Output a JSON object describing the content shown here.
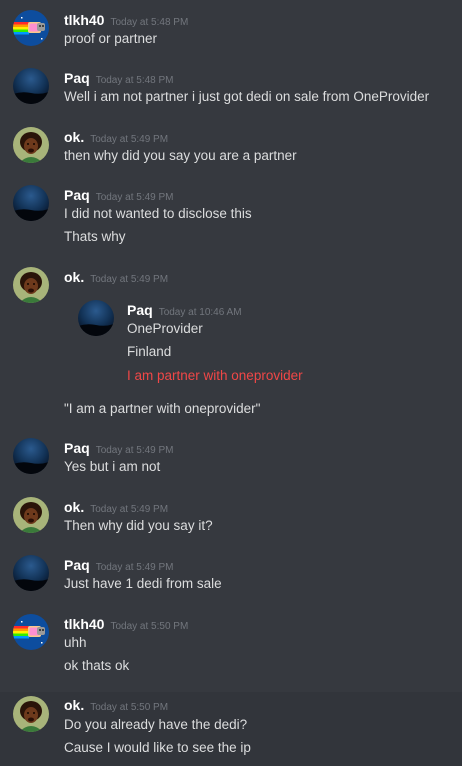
{
  "messages": [
    {
      "author": "tlkh40",
      "avatar": "nyan-cat-avatar",
      "time": "Today at 5:48 PM",
      "lines": [
        "proof or partner"
      ]
    },
    {
      "author": "Paq",
      "avatar": "night-sky-avatar",
      "time": "Today at 5:48 PM",
      "lines": [
        "Well i am not partner i just got dedi on sale from OneProvider"
      ]
    },
    {
      "author": "ok.",
      "avatar": "person-avatar",
      "time": "Today at 5:49 PM",
      "lines": [
        "then why did you say you are a partner"
      ]
    },
    {
      "author": "Paq",
      "avatar": "night-sky-avatar",
      "time": "Today at 5:49 PM",
      "lines": [
        "I did not wanted to disclose this",
        "Thats why"
      ]
    },
    {
      "author": "ok.",
      "avatar": "person-avatar",
      "time": "Today at 5:49 PM",
      "quote": {
        "author": "Paq",
        "time": "Today at 10:46 AM",
        "lines": [
          "OneProvider",
          "Finland",
          "I am partner with oneprovider"
        ]
      },
      "lines": [
        "\"I am a partner with oneprovider\""
      ]
    },
    {
      "author": "Paq",
      "avatar": "night-sky-avatar",
      "time": "Today at 5:49 PM",
      "lines": [
        "Yes but i am not"
      ]
    },
    {
      "author": "ok.",
      "avatar": "person-avatar",
      "time": "Today at 5:49 PM",
      "lines": [
        "Then why did you say it?"
      ]
    },
    {
      "author": "Paq",
      "avatar": "night-sky-avatar",
      "time": "Today at 5:49 PM",
      "lines": [
        "Just have 1 dedi from sale"
      ]
    },
    {
      "author": "tlkh40",
      "avatar": "nyan-cat-avatar",
      "time": "Today at 5:50 PM",
      "lines": [
        "uhh",
        "ok thats ok"
      ]
    },
    {
      "author": "ok.",
      "avatar": "person-avatar",
      "time": "Today at 5:50 PM",
      "lines": [
        "Do you already have the dedi?",
        "Cause I would like to see the ip"
      ]
    }
  ],
  "colors": {
    "background": "#36393f",
    "highlight_background": "#32353b",
    "username": "#ffffff",
    "timestamp": "#72767d",
    "message_text": "#dcddde",
    "quote_highlight": "#f04747"
  }
}
